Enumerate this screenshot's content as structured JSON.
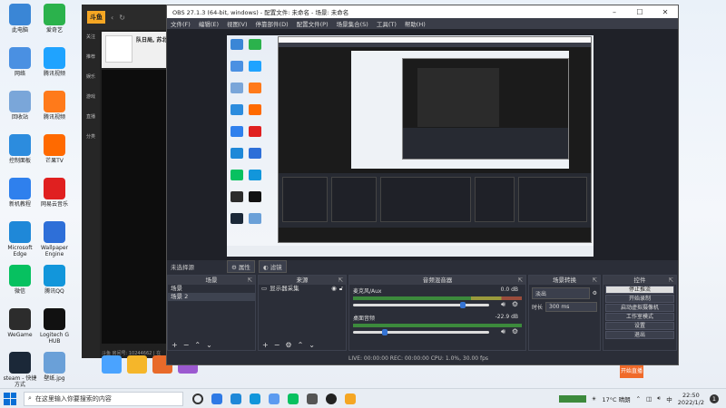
{
  "desktop_icons": [
    {
      "label": "此电脑",
      "color": "#3a86d6"
    },
    {
      "label": "爱奇艺",
      "color": "#2bb24c"
    },
    {
      "label": "网络",
      "color": "#4a90e2"
    },
    {
      "label": "腾讯视频",
      "color": "#1fa3ff"
    },
    {
      "label": "回收站",
      "color": "#7aa6d9"
    },
    {
      "label": "腾讯视频",
      "color": "#ff7a1a"
    },
    {
      "label": "控制面板",
      "color": "#2c8cde"
    },
    {
      "label": "芒果TV",
      "color": "#ff6a00"
    },
    {
      "label": "新机教程",
      "color": "#2f80ed"
    },
    {
      "label": "网易云音乐",
      "color": "#e02020"
    },
    {
      "label": "Microsoft Edge",
      "color": "#1f88d8"
    },
    {
      "label": "Wallpaper Engine",
      "color": "#2e6fd8"
    },
    {
      "label": "微信",
      "color": "#07c160"
    },
    {
      "label": "腾讯QQ",
      "color": "#1296db"
    },
    {
      "label": "WeGame",
      "color": "#2c2c2c"
    },
    {
      "label": "Logitech G HUB",
      "color": "#111111"
    },
    {
      "label": "steam - 快捷方式",
      "color": "#1b2838"
    },
    {
      "label": "壁纸.jpg",
      "color": "#6aa0d8"
    }
  ],
  "backapp": {
    "logo": "斗鱼",
    "channel": "队日局, 苏北",
    "sidebar": [
      "关注",
      "推荐",
      "娱乐",
      "游戏",
      "直播",
      "分类"
    ],
    "footer": "斗鱼 房间号: 10244662 | 在"
  },
  "obs": {
    "title": "OBS 27.1.3 (64-bit, windows) - 配置文件: 未命名 - 场景: 未命名",
    "menu": [
      "文件(F)",
      "编辑(E)",
      "视图(V)",
      "停靠部件(D)",
      "配置文件(P)",
      "场景集合(S)",
      "工具(T)",
      "帮助(H)"
    ],
    "no_source": "未选择源",
    "props_btn": "属性",
    "filters_btn": "滤镜",
    "docks": {
      "scenes": {
        "title": "场景",
        "items": [
          "场景",
          "场景 2"
        ]
      },
      "sources": {
        "title": "来源",
        "items": [
          "显示器采集"
        ]
      },
      "mixer": {
        "title": "音频混音器",
        "channels": [
          {
            "name": "麦克风/Aux",
            "db": "0.0 dB",
            "level": 0.82
          },
          {
            "name": "桌面音频",
            "db": "-22.9 dB",
            "level": 0.22
          }
        ]
      },
      "transitions": {
        "title": "场景转换",
        "type": "淡出",
        "duration_label": "时长",
        "duration": "300 ms"
      },
      "controls": {
        "title": "控件",
        "buttons": [
          "停止推流",
          "开始录制",
          "启动虚拟摄像机",
          "工作室模式",
          "设置",
          "退出"
        ]
      }
    },
    "status": "LIVE: 00:00:00   REC: 00:00:00   CPU: 1.0%, 30.00 fps"
  },
  "stream_bar": {
    "followers_label": "正式订阅",
    "button": "开始直播"
  },
  "taskbar": {
    "search_placeholder": "在这里输入你要搜索的内容",
    "weather": "17°C 晴朗",
    "time": "22:50",
    "date": "2022/1/2",
    "lang": "中",
    "notif": "1"
  }
}
